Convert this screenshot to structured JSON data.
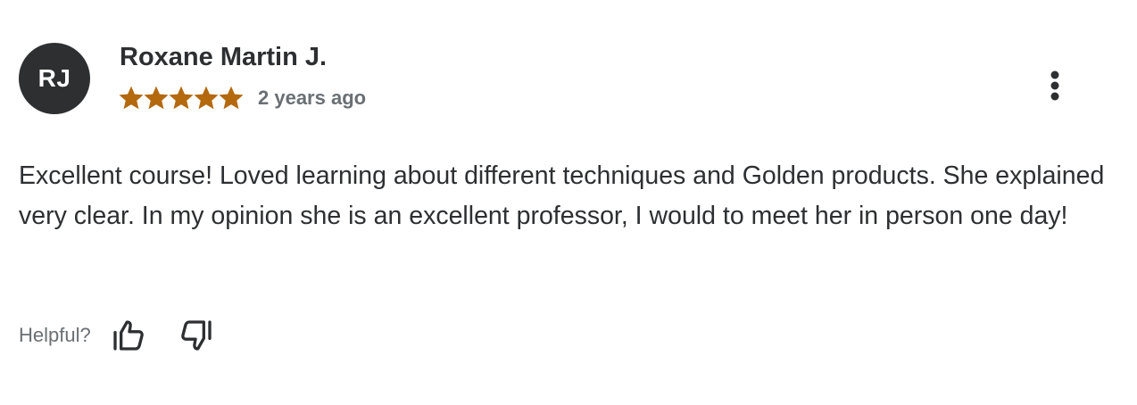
{
  "review": {
    "avatar_initials": "RJ",
    "reviewer_name": "Roxane Martin J.",
    "rating": 5,
    "rating_max": 5,
    "date": "2 years ago",
    "text": "Excellent course! Loved learning about different techniques and Golden products. She explained very clear. In my opinion she is an excellent professor, I would to meet her in person one day!",
    "helpful_label": "Helpful?"
  },
  "colors": {
    "star": "#b4690e",
    "avatar_bg": "#2d2f31",
    "text_primary": "#2d2f31",
    "text_secondary": "#6a6f73"
  },
  "icons": {
    "star": "star-icon",
    "more": "more-vertical-icon",
    "thumbs_up": "thumbs-up-icon",
    "thumbs_down": "thumbs-down-icon"
  }
}
